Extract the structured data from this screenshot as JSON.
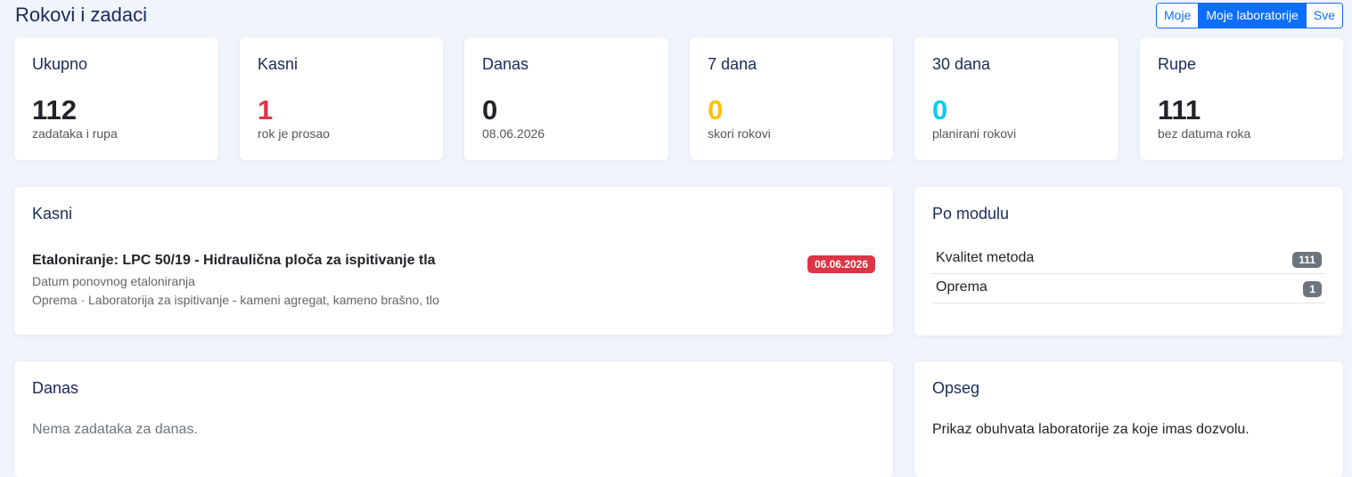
{
  "header": {
    "title": "Rokovi i zadaci",
    "scope_buttons": [
      "Moje",
      "Moje laboratorije",
      "Sve"
    ],
    "active_scope": "Moje laboratorije"
  },
  "stats": [
    {
      "title": "Ukupno",
      "value": "112",
      "sub": "zadataka i rupa"
    },
    {
      "title": "Kasni",
      "value": "1",
      "sub": "rok je prosao"
    },
    {
      "title": "Danas",
      "value": "0",
      "sub": "08.06.2026"
    },
    {
      "title": "7 dana",
      "value": "0",
      "sub": "skori rokovi"
    },
    {
      "title": "30 dana",
      "value": "0",
      "sub": "planirani rokovi"
    },
    {
      "title": "Rupe",
      "value": "111",
      "sub": "bez datuma roka"
    }
  ],
  "late": {
    "title": "Kasni",
    "item": {
      "title": "Etaloniranje: LPC 50/19 - Hidraulična ploča za ispitivanje tla",
      "line1": "Datum ponovnog etaloniranja",
      "line2": "Oprema · Laboratorija za ispitivanje - kameni agregat, kameno brašno, tlo",
      "date": "06.06.2026"
    }
  },
  "by_module": {
    "title": "Po modulu",
    "rows": [
      {
        "label": "Kvalitet metoda",
        "count": "111"
      },
      {
        "label": "Oprema",
        "count": "1"
      }
    ]
  },
  "today": {
    "title": "Danas",
    "empty": "Nema zadataka za danas."
  },
  "scope": {
    "title": "Opseg",
    "text": "Prikaz obuhvata laboratorije za koje imas dozvolu."
  },
  "colors": {
    "accent": "#0d6efd",
    "danger": "#dc3545",
    "warning": "#ffc107",
    "info": "#0dcaf0",
    "title": "#1b2a5a"
  }
}
